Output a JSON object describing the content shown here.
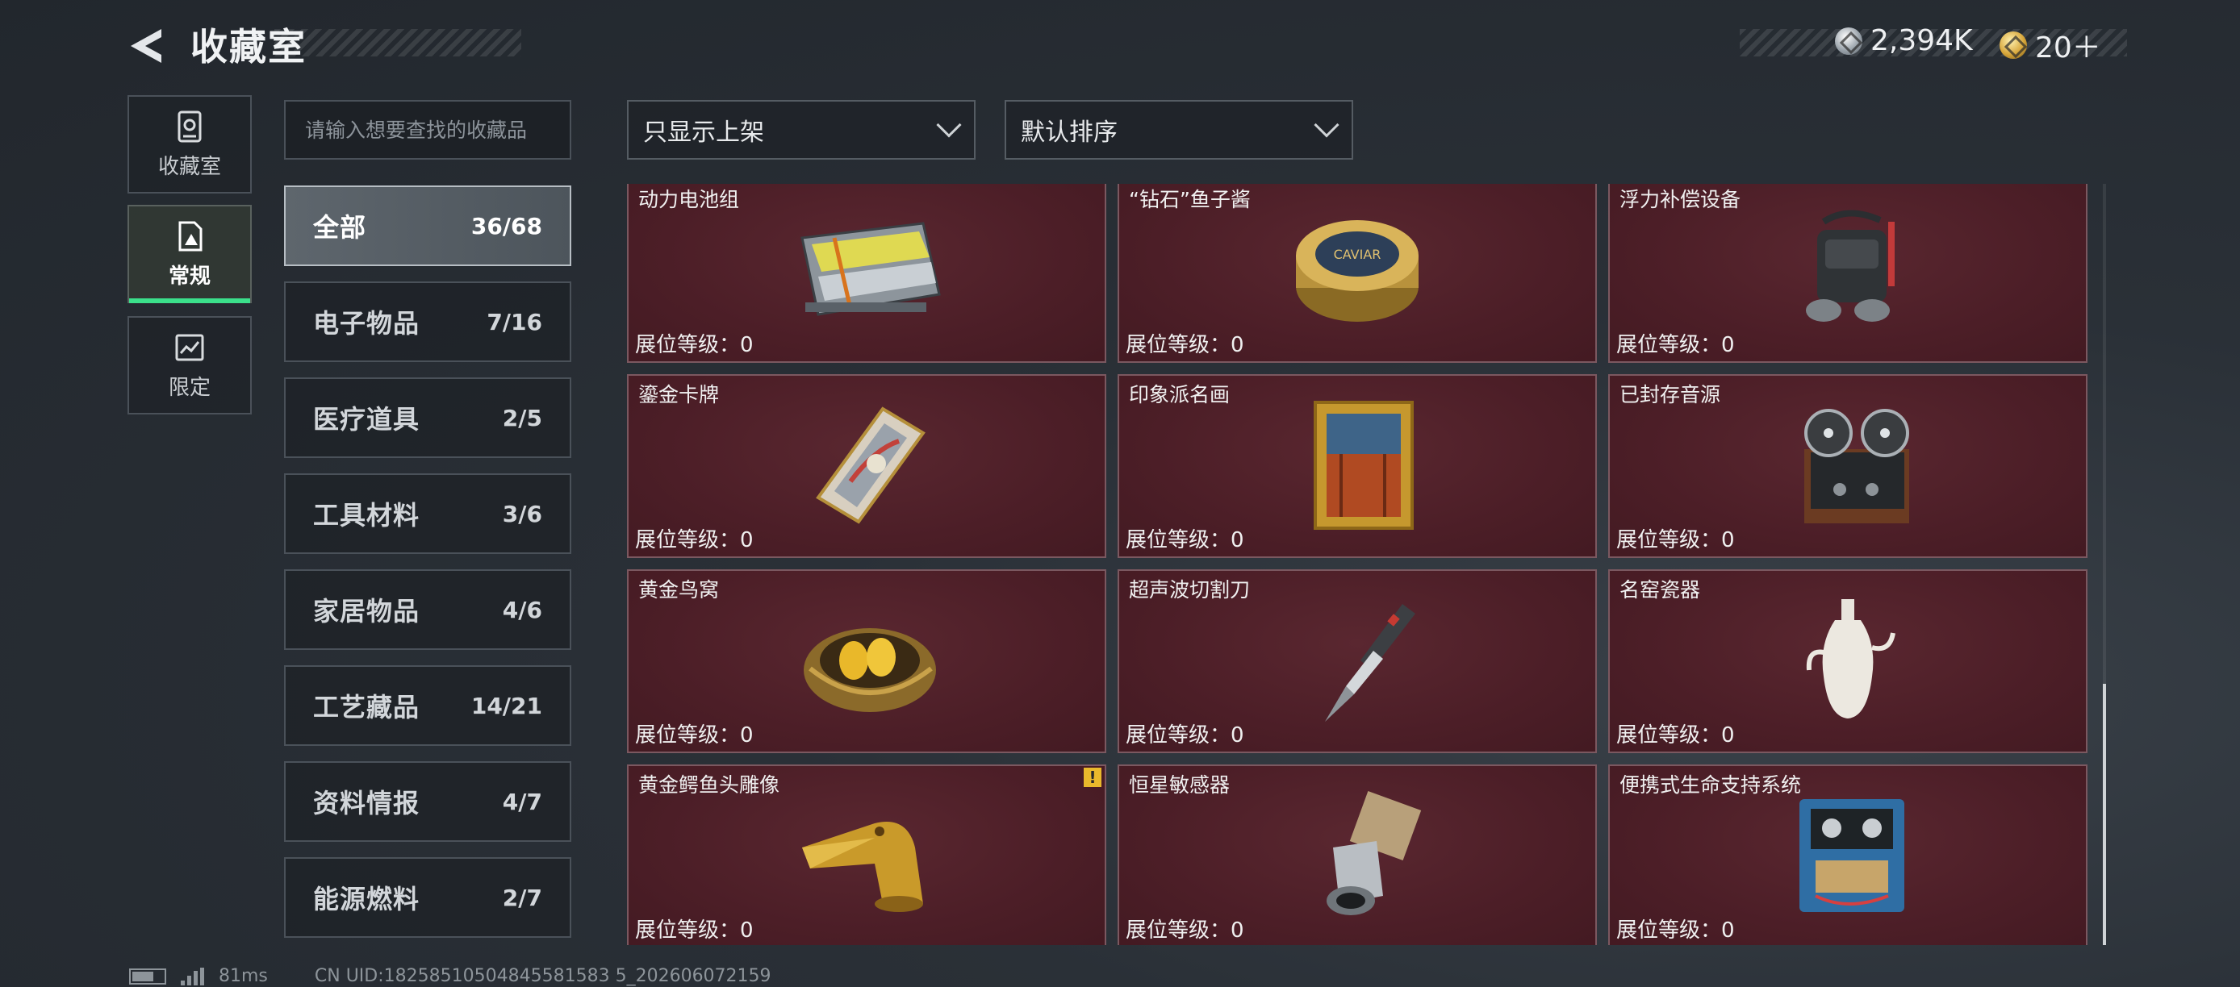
{
  "header": {
    "title": "收藏室",
    "currencies": [
      {
        "icon": "silver-coin-icon",
        "value": "2,394K"
      },
      {
        "icon": "gold-coin-icon",
        "value": "20＋"
      }
    ]
  },
  "rail": [
    {
      "label": "收藏室",
      "icon": "collection-room-icon",
      "active": false
    },
    {
      "label": "常规",
      "icon": "regular-icon",
      "active": true
    },
    {
      "label": "限定",
      "icon": "limited-icon",
      "active": false
    }
  ],
  "search": {
    "placeholder": "请输入想要查找的收藏品",
    "value": ""
  },
  "filters": {
    "shelf": {
      "value": "只显示上架"
    },
    "sort": {
      "value": "默认排序"
    }
  },
  "categories": [
    {
      "name": "全部",
      "count": "36/68",
      "active": true
    },
    {
      "name": "电子物品",
      "count": "7/16",
      "active": false
    },
    {
      "name": "医疗道具",
      "count": "2/5",
      "active": false
    },
    {
      "name": "工具材料",
      "count": "3/6",
      "active": false
    },
    {
      "name": "家居物品",
      "count": "4/6",
      "active": false
    },
    {
      "name": "工艺藏品",
      "count": "14/21",
      "active": false
    },
    {
      "name": "资料情报",
      "count": "4/7",
      "active": false
    },
    {
      "name": "能源燃料",
      "count": "2/7",
      "active": false
    }
  ],
  "level_label": "展位等级：",
  "items": [
    {
      "name": "动力电池组",
      "level": "0",
      "icon": "battery-pack-icon"
    },
    {
      "name": "“钻石”鱼子酱",
      "level": "0",
      "icon": "caviar-tin-icon",
      "tin_text": "CAVIAR"
    },
    {
      "name": "浮力补偿设备",
      "level": "0",
      "icon": "buoyancy-device-icon"
    },
    {
      "name": "鎏金卡牌",
      "level": "0",
      "icon": "gilded-card-icon"
    },
    {
      "name": "印象派名画",
      "level": "0",
      "icon": "painting-icon"
    },
    {
      "name": "已封存音源",
      "level": "0",
      "icon": "tape-recorder-icon"
    },
    {
      "name": "黄金鸟窝",
      "level": "0",
      "icon": "golden-nest-icon"
    },
    {
      "name": "超声波切割刀",
      "level": "0",
      "icon": "ultrasonic-cutter-icon"
    },
    {
      "name": "名窑瓷器",
      "level": "0",
      "icon": "porcelain-vase-icon"
    },
    {
      "name": "黄金鳄鱼头雕像",
      "level": "0",
      "icon": "gold-crocodile-icon",
      "warning": "!"
    },
    {
      "name": "恒星敏感器",
      "level": "0",
      "icon": "star-sensor-icon"
    },
    {
      "name": "便携式生命支持系统",
      "level": "0",
      "icon": "life-support-icon"
    }
  ],
  "footer": {
    "ping": "81ms",
    "uid": "CN UID:18258510504845581583 5_202606072159"
  }
}
